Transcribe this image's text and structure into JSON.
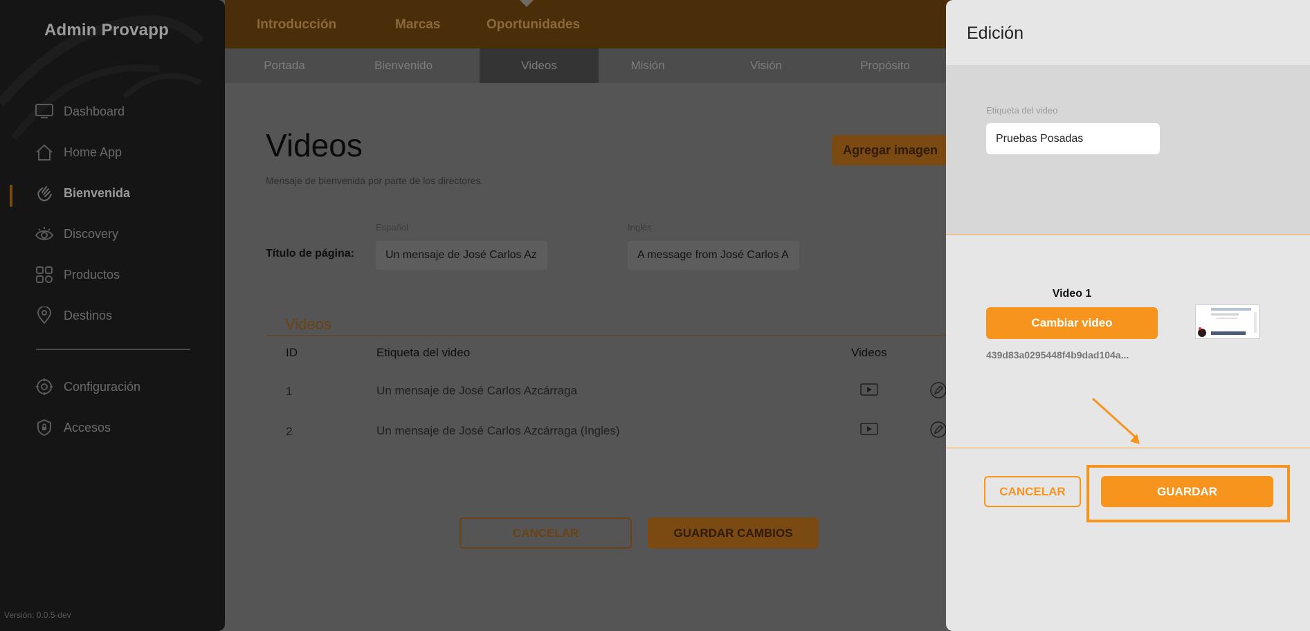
{
  "sidebar": {
    "brand": "Admin Provapp",
    "items": [
      {
        "label": "Dashboard",
        "icon": "monitor-icon"
      },
      {
        "label": "Home App",
        "icon": "home-icon"
      },
      {
        "label": "Bienvenida",
        "icon": "wave-hand-icon",
        "active": true
      },
      {
        "label": "Discovery",
        "icon": "eye-icon"
      },
      {
        "label": "Productos",
        "icon": "grid-icon"
      },
      {
        "label": "Destinos",
        "icon": "map-pin-icon"
      }
    ],
    "bottom_items": [
      {
        "label": "Configuración",
        "icon": "gear-icon"
      },
      {
        "label": "Accesos",
        "icon": "shield-lock-icon"
      }
    ],
    "version": "Versión: 0.0.5-dev"
  },
  "topbar": {
    "tabs": [
      "Introducción",
      "Marcas",
      "Oportunidades"
    ],
    "active_tab": "Introducción"
  },
  "subnav": {
    "items": [
      "Portada",
      "Bienvenido",
      "Videos",
      "Misión",
      "Visión",
      "Propósito"
    ],
    "active": "Videos"
  },
  "main": {
    "title": "Videos",
    "subtitle": "Mensaje de bienvenida por parte de los directores.",
    "add_image_label": "Agregar imagen",
    "title_field": {
      "label": "Título de página:",
      "spanish_label": "Español",
      "spanish_value": "Un mensaje de José Carlos Az",
      "english_label": "Inglés",
      "english_value": "A message from José Carlos A"
    },
    "videos_section": {
      "title": "Videos",
      "columns": [
        "ID",
        "Etiqueta del video",
        "Videos"
      ],
      "rows": [
        {
          "id": "1",
          "label": "Un mensaje de José Carlos Azcárraga"
        },
        {
          "id": "2",
          "label": "Un mensaje de José Carlos Azcárraga (Ingles)"
        }
      ]
    },
    "cancel_label": "CANCELAR",
    "save_changes_label": "GUARDAR CAMBIOS"
  },
  "panel": {
    "title": "Edición",
    "field_label": "Etiqueta del video",
    "field_value": "Pruebas Posadas",
    "video_title": "Video 1",
    "change_video_label": "Cambiar video",
    "video_hash": "439d83a0295448f4b9dad104a...",
    "cancel_label": "CANCELAR",
    "save_label": "GUARDAR"
  },
  "colors": {
    "accent": "#f7941d",
    "sidebar_bg": "#151515",
    "overlay_bg": "#555555",
    "panel_bg": "#e6e6e6"
  }
}
